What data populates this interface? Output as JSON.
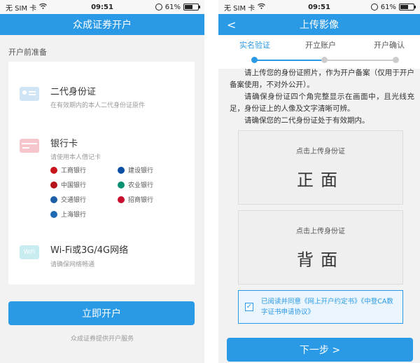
{
  "status_left": {
    "carrier": "无 SIM 卡",
    "time": "09:51",
    "battery": "61%"
  },
  "status_right": {
    "carrier": "无 SIM 卡",
    "time": "09:51",
    "battery": "61%"
  },
  "left_screen": {
    "title": "众成证券开户",
    "section": "开户前准备",
    "id_item": {
      "title": "二代身份证",
      "subtitle": "在有效期内的本人二代身份证原件"
    },
    "bank_item": {
      "title": "银行卡",
      "subtitle": "请使用本人借记卡",
      "banks": [
        "工商银行",
        "建设银行",
        "中国银行",
        "农业银行",
        "交通银行",
        "招商银行",
        "上海银行"
      ],
      "bank_colors": [
        "#c9161c",
        "#0a4fa3",
        "#b5121b",
        "#0a9171",
        "#1d5ea8",
        "#c8102e",
        "#1d6ab3"
      ]
    },
    "wifi_item": {
      "icon_text": "WiFi",
      "title": "Wi-Fi或3G/4G网络",
      "subtitle": "请确保网络畅通"
    },
    "open_button": "立即开户",
    "footer": "众成证券提供开户服务"
  },
  "right_screen": {
    "back_glyph": "<",
    "title": "上传影像",
    "steps": [
      {
        "label": "实名验证",
        "active": true
      },
      {
        "label": "开立账户",
        "active": false
      },
      {
        "label": "开户确认",
        "active": false
      }
    ],
    "step_progress": 0.5,
    "instructions": [
      "请上传您的身份证照片，作为开户备案（仅用于开户备案使用，不对外公开）。",
      "请确保身份证四个角完整显示在画面中，且光线充足，身份证上的人像及文字清晰可辨。",
      "请确保您的二代身份证处于有效期内。"
    ],
    "front_upload": {
      "hint": "点击上传身份证",
      "label": "正面"
    },
    "back_upload": {
      "hint": "点击上传身份证",
      "label": "背面"
    },
    "agreement": {
      "checked": true,
      "check_glyph": "✓",
      "text": "已阅读并同意《网上开户约定书》《中登CA数字证书申请协议》"
    },
    "next_button": "下一步 >"
  },
  "colors": {
    "accent": "#2b9ae6",
    "background": "#f2f2f2"
  }
}
